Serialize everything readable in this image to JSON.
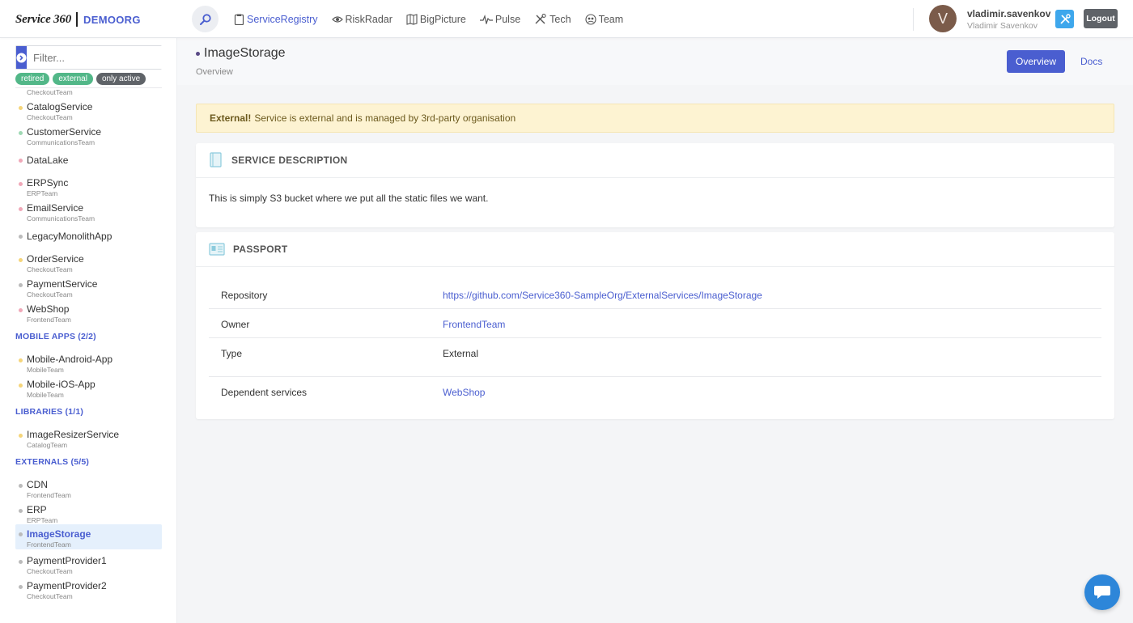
{
  "header": {
    "logo_text": "Service 360",
    "org": "DEMOORG",
    "nav": [
      {
        "label": "ServiceRegistry",
        "icon": "clipboard-icon",
        "active": true
      },
      {
        "label": "RiskRadar",
        "icon": "eye-icon"
      },
      {
        "label": "BigPicture",
        "icon": "map-icon"
      },
      {
        "label": "Pulse",
        "icon": "pulse-icon"
      },
      {
        "label": "Tech",
        "icon": "tools-icon"
      },
      {
        "label": "Team",
        "icon": "team-icon"
      }
    ],
    "user": {
      "initial": "V",
      "login": "vladimir.savenkov",
      "name": "Vladimir Savenkov"
    },
    "logout_label": "Logout"
  },
  "sidebar": {
    "filter_placeholder": "Filter...",
    "tags": [
      "retired",
      "external",
      "only active"
    ],
    "top_team": "CheckoutTeam",
    "services": [
      {
        "name": "CatalogService",
        "team": "CheckoutTeam",
        "dot": "#f5d57a"
      },
      {
        "name": "CustomerService",
        "team": "CommunicationsTeam",
        "dot": "#9fd9b4"
      },
      {
        "name": "DataLake",
        "team": "",
        "dot": "#f0a8b8"
      },
      {
        "name": "ERPSync",
        "team": "ERPTeam",
        "dot": "#f0a8b8"
      },
      {
        "name": "EmailService",
        "team": "CommunicationsTeam",
        "dot": "#f0a8b8"
      },
      {
        "name": "LegacyMonolithApp",
        "team": "",
        "dot": "#bbbbbb"
      },
      {
        "name": "OrderService",
        "team": "CheckoutTeam",
        "dot": "#f5d57a"
      },
      {
        "name": "PaymentService",
        "team": "CheckoutTeam",
        "dot": "#bbbbbb"
      },
      {
        "name": "WebShop",
        "team": "FrontendTeam",
        "dot": "#f0a8b8"
      }
    ],
    "mobile_title": "MOBILE APPS (2/2)",
    "mobile": [
      {
        "name": "Mobile-Android-App",
        "team": "MobileTeam",
        "dot": "#f5d57a"
      },
      {
        "name": "Mobile-iOS-App",
        "team": "MobileTeam",
        "dot": "#f5d57a"
      }
    ],
    "libraries_title": "LIBRARIES (1/1)",
    "libraries": [
      {
        "name": "ImageResizerService",
        "team": "CatalogTeam",
        "dot": "#f5d57a"
      }
    ],
    "externals_title": "EXTERNALS (5/5)",
    "externals": [
      {
        "name": "CDN",
        "team": "FrontendTeam",
        "dot": "#bbbbbb"
      },
      {
        "name": "ERP",
        "team": "ERPTeam",
        "dot": "#bbbbbb"
      },
      {
        "name": "ImageStorage",
        "team": "FrontendTeam",
        "dot": "#bbbbbb",
        "selected": true
      },
      {
        "name": "PaymentProvider1",
        "team": "CheckoutTeam",
        "dot": "#bbbbbb"
      },
      {
        "name": "PaymentProvider2",
        "team": "CheckoutTeam",
        "dot": "#bbbbbb"
      }
    ]
  },
  "page": {
    "title": "ImageStorage",
    "subtitle": "Overview",
    "overview_label": "Overview",
    "docs_label": "Docs"
  },
  "alert": {
    "strong": "External!",
    "text": "Service is external and is managed by 3rd-party organisation"
  },
  "description": {
    "title": "SERVICE DESCRIPTION",
    "text": "This is simply S3 bucket where we put all the static files we want."
  },
  "passport": {
    "title": "PASSPORT",
    "rows": [
      {
        "key": "Repository",
        "value": "https://github.com/Service360-SampleOrg/ExternalServices/ImageStorage",
        "link": true
      },
      {
        "key": "Owner",
        "value": "FrontendTeam",
        "link": true
      },
      {
        "key": "Type",
        "value": "External",
        "link": false
      },
      {
        "key": "Dependent services",
        "value": "WebShop",
        "link": true
      }
    ]
  }
}
